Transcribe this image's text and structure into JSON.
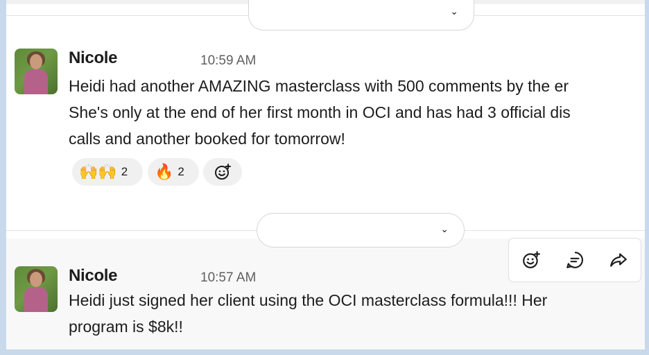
{
  "messages": [
    {
      "sender": "Nicole",
      "time": "10:59 AM",
      "lines": [
        "Heidi had another AMAZING masterclass with 500 comments by the er",
        "She's only at the end of her first month in OCI and has had 3 official dis",
        "calls and another booked for tomorrow!"
      ],
      "reactions": [
        {
          "emoji": "🙌🙌",
          "count": "2"
        },
        {
          "emoji": "🔥",
          "count": "2"
        }
      ]
    },
    {
      "sender": "Nicole",
      "time": "10:57 AM",
      "lines": [
        "Heidi just signed her client using the OCI masterclass formula!!! Her",
        "program is $8k!!"
      ]
    }
  ],
  "icons": {
    "date_chevron": "chevron-down-icon",
    "add_reaction": "add-reaction-icon",
    "reply_thread": "thread-icon",
    "share": "share-forward-icon"
  },
  "colors": {
    "frame": "#c9d9ec",
    "hover_bg": "#f8f8f8",
    "reaction_bg": "#f0f0f0"
  }
}
